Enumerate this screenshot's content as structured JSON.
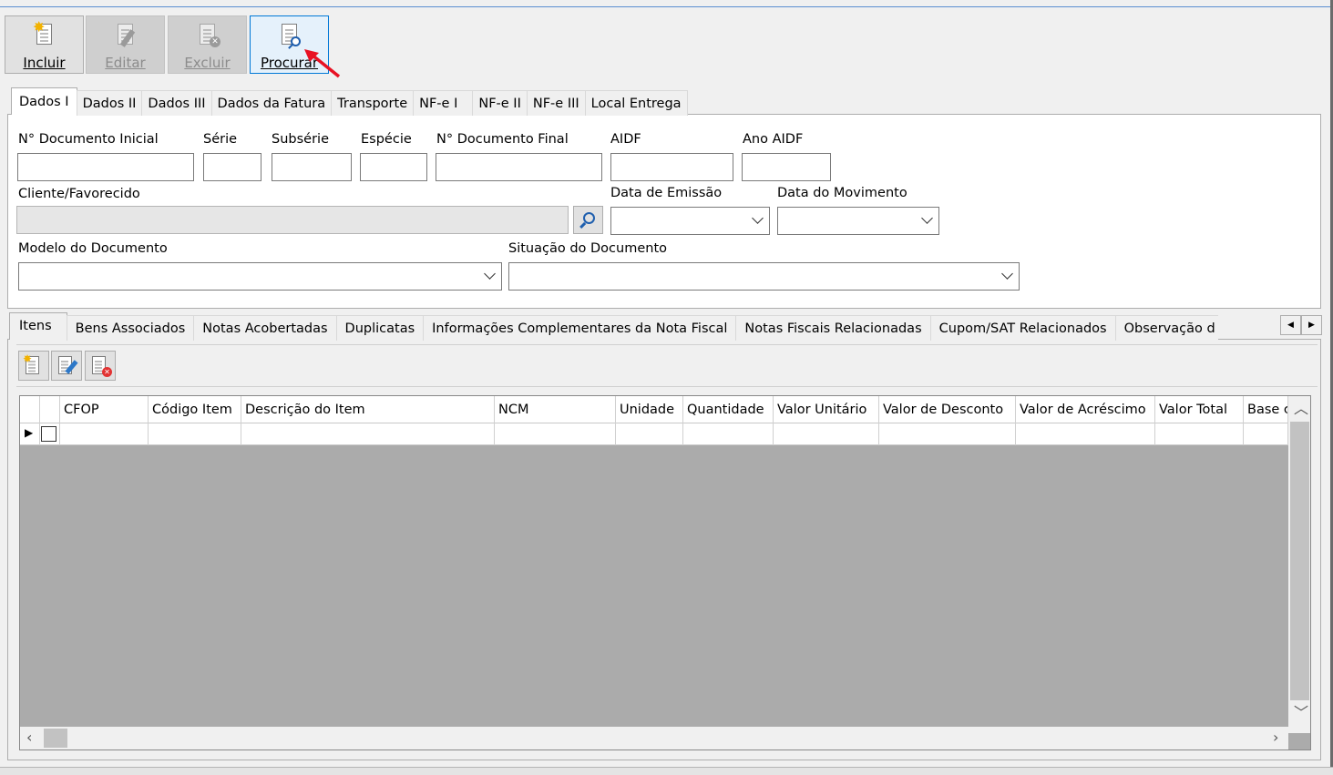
{
  "toolbar": {
    "incluir": "Incluir",
    "editar": "Editar",
    "excluir": "Excluir",
    "procurar": "Procurar"
  },
  "tabs_top": [
    "Dados I",
    "Dados II",
    "Dados III",
    "Dados da Fatura",
    "Transporte",
    "NF-e I",
    "NF-e II",
    "NF-e III",
    "Local Entrega"
  ],
  "form": {
    "n_documento_inicial": "N° Documento Inicial",
    "serie": "Série",
    "subserie": "Subsérie",
    "especie": "Espécie",
    "n_documento_final": "N° Documento Final",
    "aidf": "AIDF",
    "ano_aidf": "Ano AIDF",
    "cliente_favorecido": "Cliente/Favorecido",
    "data_emissao": "Data de Emissão",
    "data_movimento": "Data do Movimento",
    "modelo_documento": "Modelo do Documento",
    "situacao_documento": "Situação do Documento"
  },
  "tabs_bottom": [
    "Itens",
    "Bens Associados",
    "Notas Acobertadas",
    "Duplicatas",
    "Informações Complementares da Nota Fiscal",
    "Notas Fiscais Relacionadas",
    "Cupom/SAT Relacionados",
    "Observação d"
  ],
  "grid": {
    "columns": [
      "CFOP",
      "Código Item",
      "Descrição do Item",
      "NCM",
      "Unidade",
      "Quantidade",
      "Valor Unitário",
      "Valor de Desconto",
      "Valor de Acréscimo",
      "Valor Total",
      "Base c"
    ]
  },
  "colors": {
    "accent": "#0078d7",
    "arrow": "#e81123"
  }
}
